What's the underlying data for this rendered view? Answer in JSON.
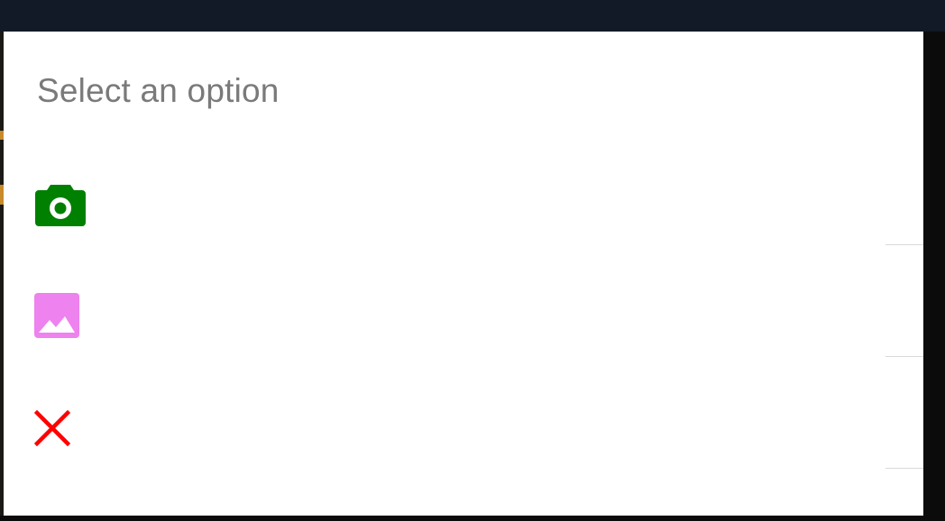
{
  "sheet": {
    "title": "Select an option",
    "options": [
      {
        "id": "camera",
        "label": "",
        "icon": "camera-icon",
        "color": "#008000"
      },
      {
        "id": "gallery",
        "label": "",
        "icon": "image-icon",
        "color": "#ee82ee"
      },
      {
        "id": "cancel",
        "label": "",
        "icon": "close-icon",
        "color": "#ff0000"
      }
    ]
  }
}
